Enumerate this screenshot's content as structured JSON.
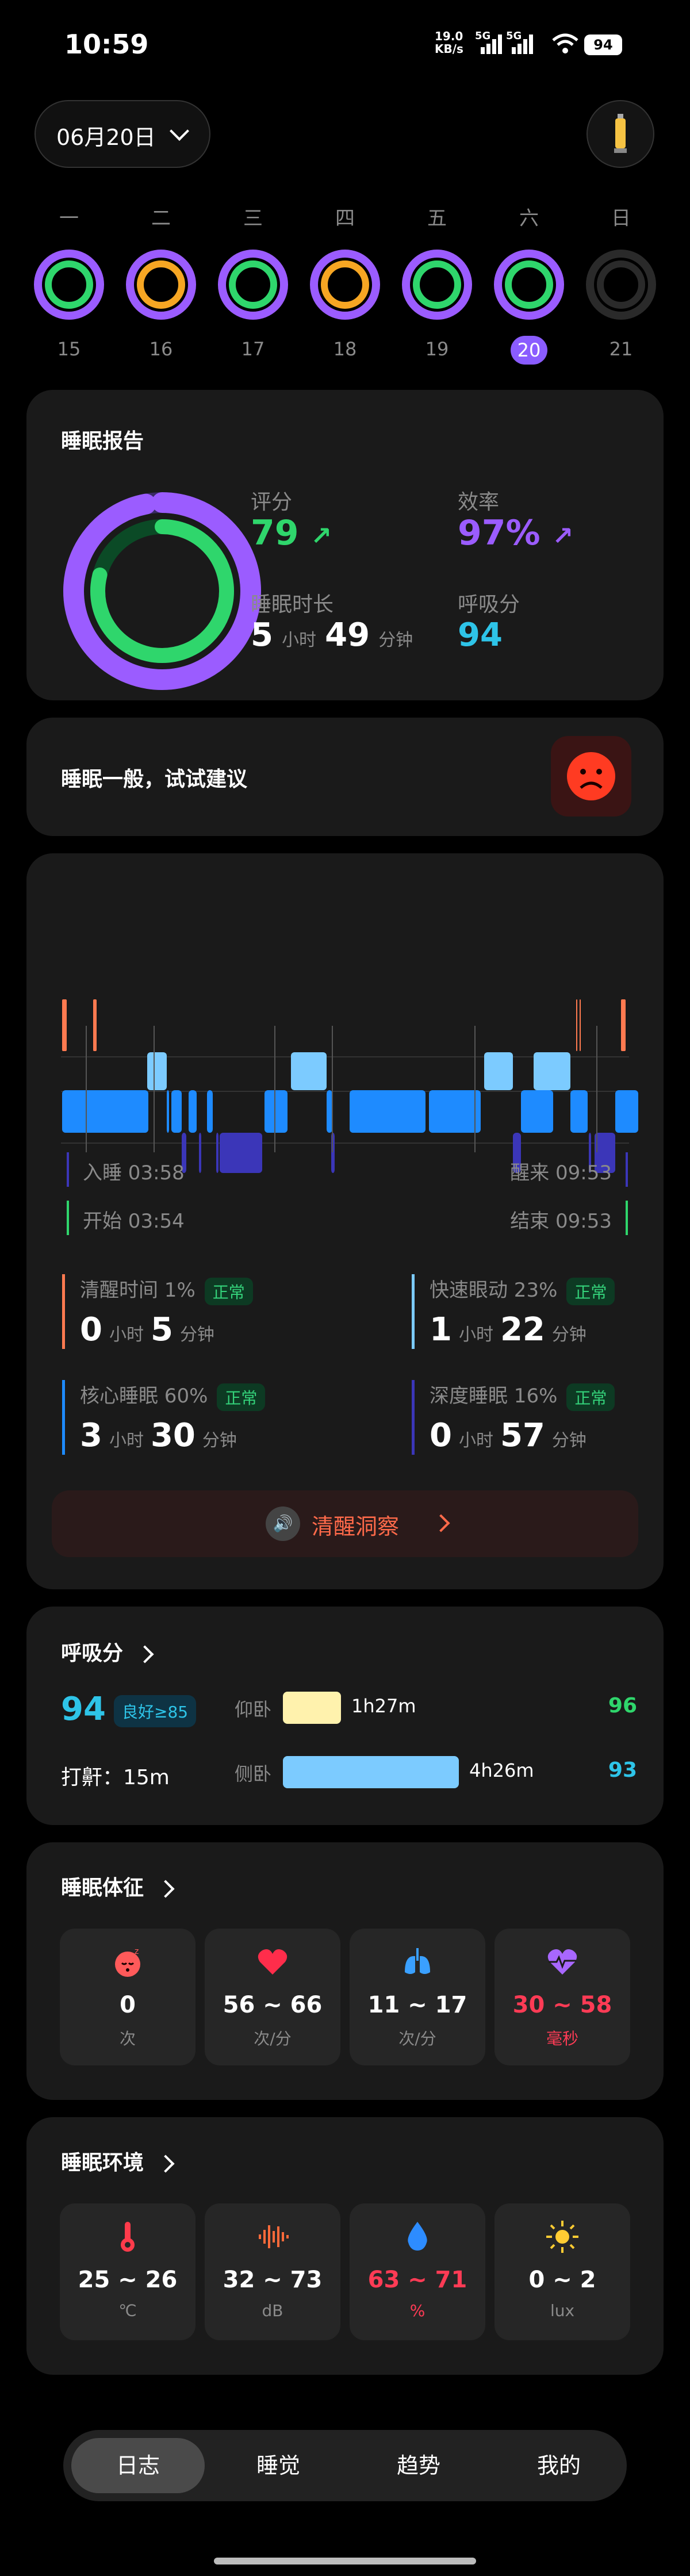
{
  "status_bar": {
    "time": "10:59",
    "net_speed_top": "19.0",
    "net_speed_bottom": "KB/s",
    "signal1": "5G",
    "signal2": "5G",
    "battery": "94"
  },
  "header": {
    "date": "06月20日"
  },
  "week": {
    "days": [
      {
        "weekday": "一",
        "date": "15",
        "inner": "#2fd66c"
      },
      {
        "weekday": "二",
        "date": "16",
        "inner": "#f6a623"
      },
      {
        "weekday": "三",
        "date": "17",
        "inner": "#2fd66c"
      },
      {
        "weekday": "四",
        "date": "18",
        "inner": "#f6a623"
      },
      {
        "weekday": "五",
        "date": "19",
        "inner": "#2fd66c"
      },
      {
        "weekday": "六",
        "date": "20",
        "inner": "#2fd66c"
      },
      {
        "weekday": "日",
        "date": "21",
        "inner": "#2a2a2a"
      }
    ],
    "selected_index": 5
  },
  "report": {
    "title": "睡眠报告",
    "score_label": "评分",
    "score": "79",
    "efficiency_label": "效率",
    "efficiency": "97%",
    "duration_label": "睡眠时长",
    "dur_h": "5",
    "dur_h_unit": "小时",
    "dur_m": "49",
    "dur_m_unit": "分钟",
    "breath_label": "呼吸分",
    "breath": "94",
    "ring_outer_fraction": 0.97,
    "ring_inner_fraction": 0.79
  },
  "advice": {
    "text": "睡眠一般，试试建议"
  },
  "hypnogram": {
    "fall_asleep": "入睡 03:58",
    "wake_up": "醒来 09:53",
    "start": "开始 03:54",
    "end": "结束 09:53",
    "stages": [
      {
        "label": "清醒时间 1%",
        "tag": "正常",
        "h": "0",
        "h_unit": "小时",
        "m": "5",
        "m_unit": "分钟",
        "color": "#ff7a50"
      },
      {
        "label": "快速眼动 23%",
        "tag": "正常",
        "h": "1",
        "h_unit": "小时",
        "m": "22",
        "m_unit": "分钟",
        "color": "#7ccbff"
      },
      {
        "label": "核心睡眠 60%",
        "tag": "正常",
        "h": "3",
        "h_unit": "小时",
        "m": "30",
        "m_unit": "分钟",
        "color": "#1e8bff"
      },
      {
        "label": "深度睡眠 16%",
        "tag": "正常",
        "h": "0",
        "h_unit": "小时",
        "m": "57",
        "m_unit": "分钟",
        "color": "#3b36b8"
      }
    ],
    "insight_button": "清醒洞察"
  },
  "breathing": {
    "title": "呼吸分",
    "score": "94",
    "badge": "良好≥85",
    "snore": "打鼾：15m",
    "positions": [
      {
        "label": "仰卧",
        "duration": "1h27m",
        "value": "96",
        "color": "#fff2ad",
        "fraction": 0.33
      },
      {
        "label": "侧卧",
        "duration": "4h26m",
        "value": "93",
        "color": "#7ccbff",
        "fraction": 1.0
      }
    ]
  },
  "vitals": {
    "title": "睡眠体征",
    "items": [
      {
        "value": "0",
        "unit": "次",
        "icon": "sleep-face-icon",
        "color": "#ff5a5a",
        "value_color": "#ffffff"
      },
      {
        "value": "56 ~ 66",
        "unit": "次/分",
        "icon": "heart-icon",
        "color": "#ff2d4b",
        "value_color": "#ffffff"
      },
      {
        "value": "11 ~ 17",
        "unit": "次/分",
        "icon": "lungs-icon",
        "color": "#3aa0ff",
        "value_color": "#ffffff"
      },
      {
        "value": "30 ~ 58",
        "unit": "毫秒",
        "icon": "heart-rate-icon",
        "color": "#a867ff",
        "value_color": "#ff3b55"
      }
    ]
  },
  "environment": {
    "title": "睡眠环境",
    "items": [
      {
        "value": "25 ~ 26",
        "unit": "℃",
        "icon": "thermometer-icon",
        "color": "#ff3b4b",
        "value_color": "#ffffff"
      },
      {
        "value": "32 ~ 73",
        "unit": "dB",
        "icon": "sound-wave-icon",
        "color": "#ff6a3a",
        "value_color": "#ffffff"
      },
      {
        "value": "63 ~ 71",
        "unit": "%",
        "icon": "water-drop-icon",
        "color": "#2d8cff",
        "value_color": "#ff3b55"
      },
      {
        "value": "0 ~ 2",
        "unit": "lux",
        "icon": "sun-icon",
        "color": "#ffcc33",
        "value_color": "#ffffff"
      }
    ]
  },
  "tabbar": {
    "tabs": [
      "日志",
      "睡觉",
      "趋势",
      "我的"
    ],
    "active": 0
  }
}
